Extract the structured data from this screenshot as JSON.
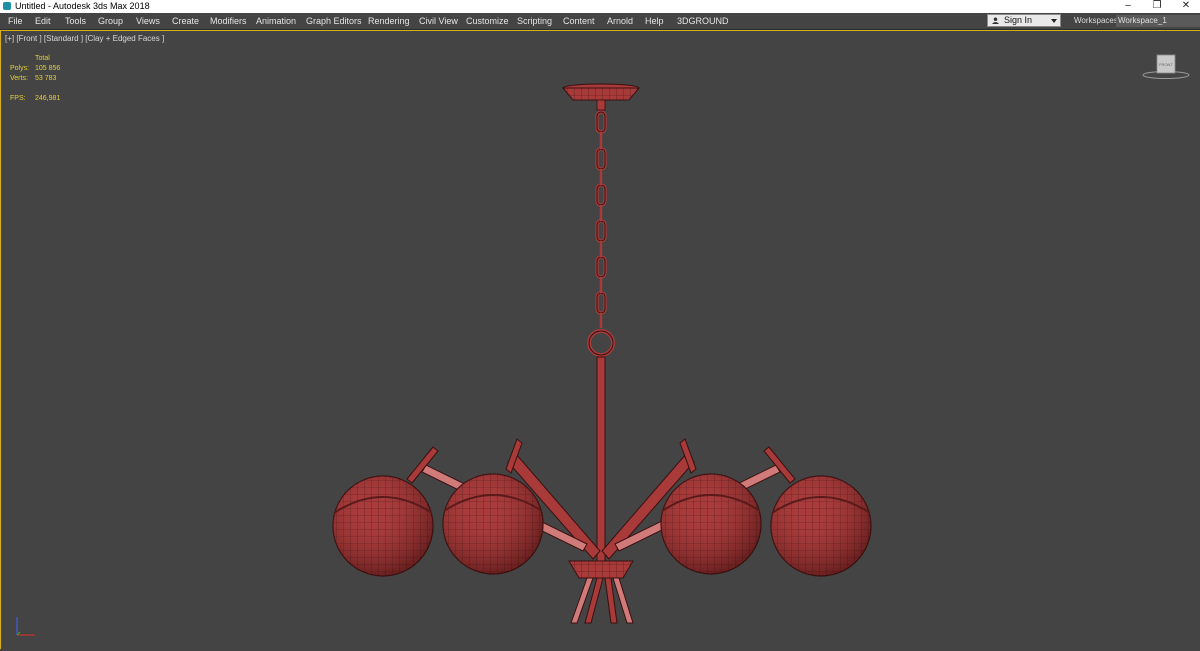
{
  "window": {
    "title": "Untitled - Autodesk 3ds Max 2018",
    "minimize_icon": "–",
    "restore_icon": "❐",
    "close_icon": "✕"
  },
  "menu": [
    {
      "label": "File"
    },
    {
      "label": "Edit"
    },
    {
      "label": "Tools"
    },
    {
      "label": "Group"
    },
    {
      "label": "Views"
    },
    {
      "label": "Create"
    },
    {
      "label": "Modifiers"
    },
    {
      "label": "Animation"
    },
    {
      "label": "Graph Editors"
    },
    {
      "label": "Rendering"
    },
    {
      "label": "Civil View"
    },
    {
      "label": "Customize"
    },
    {
      "label": "Scripting"
    },
    {
      "label": "Content"
    },
    {
      "label": "Arnold"
    },
    {
      "label": "Help"
    },
    {
      "label": "3DGROUND"
    }
  ],
  "account": {
    "sign_in": "Sign In"
  },
  "workspaces": {
    "label": "Workspaces:",
    "value": "Workspace_1"
  },
  "viewport": {
    "label": "[+] [Front ] [Standard ] [Clay + Edged Faces ]",
    "stats": {
      "header": "Total",
      "polys_label": "Polys:",
      "polys_value": "105 856",
      "verts_label": "Verts:",
      "verts_value": "53 783",
      "fps_label": "FPS:",
      "fps_value": "246,981"
    },
    "viewcube_label": "FRONT"
  },
  "colors": {
    "viewport_bg": "#444444",
    "model_red": "#a83a3a",
    "model_wire": "#3a1010",
    "stats_yellow": "#e3cf3a",
    "active_border": "#d7b11a"
  }
}
